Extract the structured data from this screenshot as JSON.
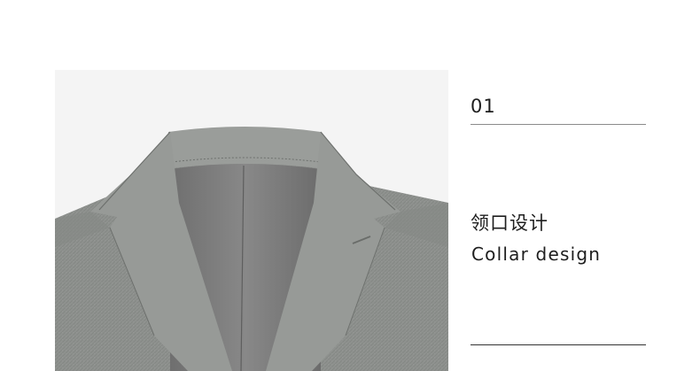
{
  "feature": {
    "index": "01",
    "title_cn": "领口设计",
    "title_en": "Collar design"
  },
  "colors": {
    "photo_background": "#f4f4f4",
    "suit_fabric": "#8c8f8c",
    "lining": "#7a7a7a",
    "text": "#1e1e1e",
    "divider": "#8a8a8a"
  },
  "image": {
    "subject": "grey-suit-jacket-collar"
  }
}
